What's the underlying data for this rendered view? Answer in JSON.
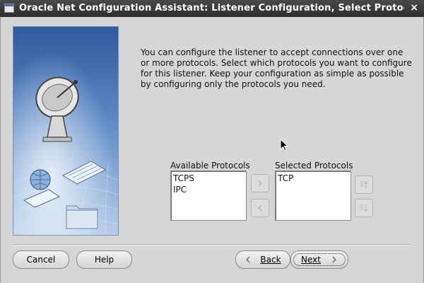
{
  "window": {
    "title": "Oracle Net Configuration Assistant: Listener Configuration, Select Protocols",
    "close_glyph": "×"
  },
  "description": "You can configure the listener to accept connections over one or more protocols. Select which protocols you want to configure for this listener. Keep your configuration as simple as possible by configuring only the protocols you need.",
  "available": {
    "label": "Available Protocols",
    "items": [
      "TCPS",
      "IPC"
    ]
  },
  "selected": {
    "label": "Selected Protocols",
    "items": [
      "TCP"
    ]
  },
  "buttons": {
    "cancel": "Cancel",
    "help": "Help",
    "back": "Back",
    "next": "Next"
  }
}
